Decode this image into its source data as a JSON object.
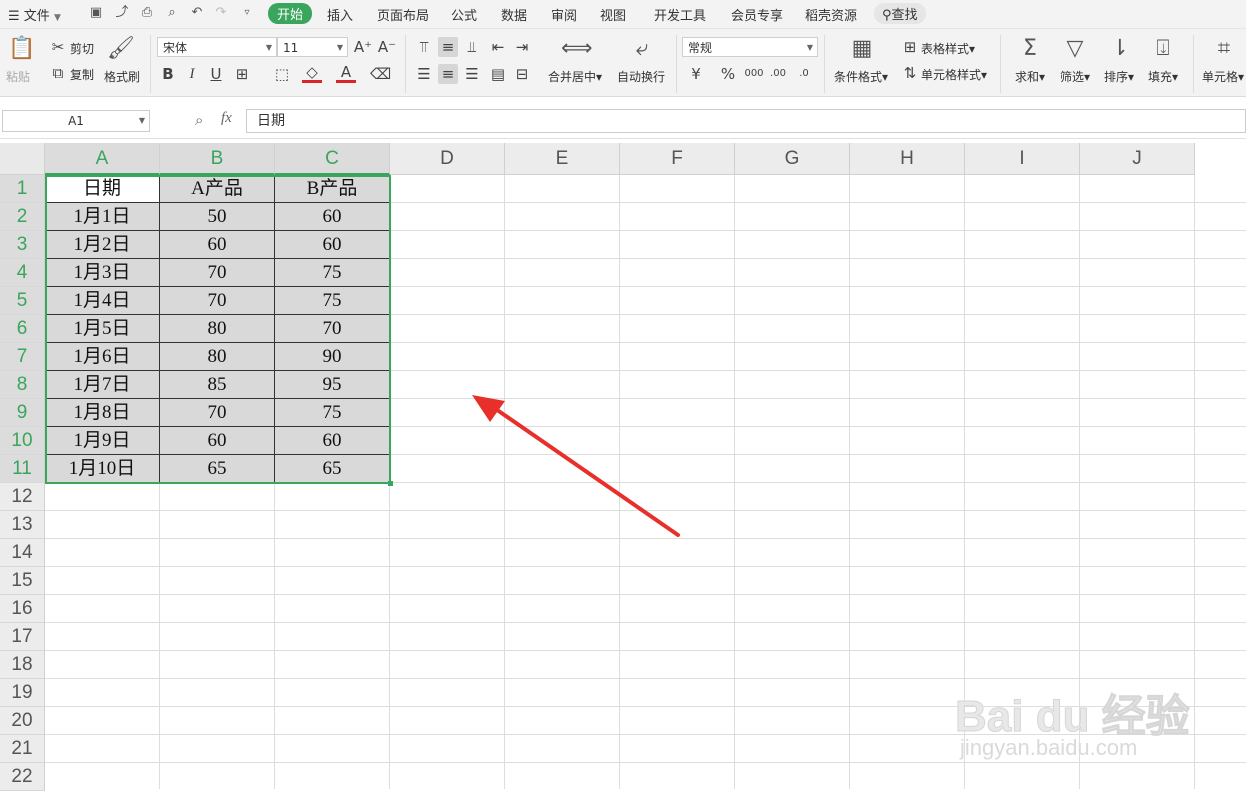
{
  "menubar": {
    "file_label": "文件",
    "tabs": [
      "开始",
      "插入",
      "页面布局",
      "公式",
      "数据",
      "审阅",
      "视图",
      "开发工具",
      "会员专享",
      "稻壳资源"
    ],
    "active_tab": "开始",
    "search_label": "查找"
  },
  "ribbon": {
    "paste": "粘贴",
    "cut": "剪切",
    "copy": "复制",
    "format_painter": "格式刷",
    "font_name": "宋体",
    "font_size": "11",
    "merge_center": "合并居中",
    "wrap_text": "自动换行",
    "number_format": "常规",
    "conditional_format": "条件格式",
    "table_style": "表格样式",
    "cell_style": "单元格样式",
    "sum": "求和",
    "filter": "筛选",
    "sort": "排序",
    "fill": "填充",
    "cell": "单元格"
  },
  "formula_bar": {
    "name_box": "A1",
    "fx_label": "fx",
    "content": "日期"
  },
  "grid": {
    "columns": [
      "A",
      "B",
      "C",
      "D",
      "E",
      "F",
      "G",
      "H",
      "I",
      "J"
    ],
    "rows": [
      "1",
      "2",
      "3",
      "4",
      "5",
      "6",
      "7",
      "8",
      "9",
      "10",
      "11",
      "12",
      "13",
      "14",
      "15",
      "16",
      "17",
      "18",
      "19",
      "20",
      "21",
      "22"
    ],
    "table": [
      [
        "日期",
        "A产品",
        "B产品"
      ],
      [
        "1月1日",
        "50",
        "60"
      ],
      [
        "1月2日",
        "60",
        "60"
      ],
      [
        "1月3日",
        "70",
        "75"
      ],
      [
        "1月4日",
        "70",
        "75"
      ],
      [
        "1月5日",
        "80",
        "70"
      ],
      [
        "1月6日",
        "80",
        "90"
      ],
      [
        "1月7日",
        "85",
        "95"
      ],
      [
        "1月8日",
        "70",
        "75"
      ],
      [
        "1月9日",
        "60",
        "60"
      ],
      [
        "1月10日",
        "65",
        "65"
      ]
    ]
  },
  "watermark": {
    "brand": "Bai du 经验",
    "url": "jingyan.baidu.com"
  },
  "colors": {
    "accent": "#3aa55c",
    "selection_fill": "#d9d9d9",
    "arrow": "#e8302a"
  }
}
